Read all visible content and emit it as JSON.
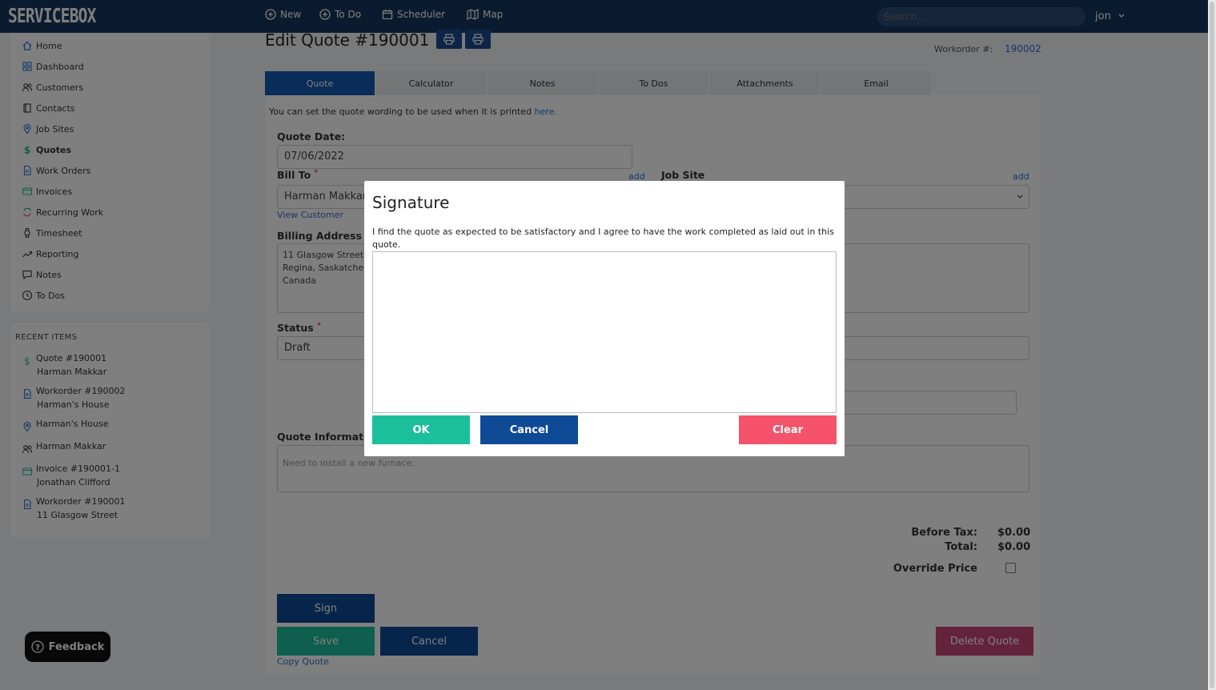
{
  "colors": {
    "navbar": "#17365e",
    "primary": "#0e5bb0",
    "ok": "#1cbf9b",
    "cancel": "#0e4a96",
    "clear": "#f4536b",
    "link": "#2a6fd6"
  },
  "topbar": {
    "logo": "SERVICEBOX",
    "nav": [
      {
        "label": "New",
        "icon": "plus-circle-icon"
      },
      {
        "label": "To Do",
        "icon": "plus-circle-icon"
      },
      {
        "label": "Scheduler",
        "icon": "calendar-icon"
      },
      {
        "label": "Map",
        "icon": "map-icon"
      }
    ],
    "search_placeholder": "Search...",
    "user": "jon"
  },
  "sidebar": {
    "items": [
      {
        "label": "Home",
        "icon": "home-icon"
      },
      {
        "label": "Dashboard",
        "icon": "grid-icon"
      },
      {
        "label": "Customers",
        "icon": "users-icon"
      },
      {
        "label": "Contacts",
        "icon": "book-icon"
      },
      {
        "label": "Job Sites",
        "icon": "location-pin-icon"
      },
      {
        "label": "Quotes",
        "icon": "dollar-icon",
        "active": true
      },
      {
        "label": "Work Orders",
        "icon": "document-icon"
      },
      {
        "label": "Invoices",
        "icon": "credit-card-icon"
      },
      {
        "label": "Recurring Work",
        "icon": "refresh-icon"
      },
      {
        "label": "Timesheet",
        "icon": "watch-icon"
      },
      {
        "label": "Reporting",
        "icon": "trend-icon"
      },
      {
        "label": "Notes",
        "icon": "chat-icon"
      },
      {
        "label": "To Dos",
        "icon": "clock-icon"
      }
    ],
    "recent_title": "RECENT ITEMS",
    "recent": [
      {
        "title": "Quote #190001",
        "sub": "Harman Makkar",
        "icon": "dollar-icon"
      },
      {
        "title": "Workorder #190002",
        "sub": "Harman's House",
        "icon": "document-icon"
      },
      {
        "title": "Harman's House",
        "sub": "",
        "icon": "location-pin-icon"
      },
      {
        "title": "Harman Makkar",
        "sub": "",
        "icon": "users-icon"
      },
      {
        "title": "Invoice #190001-1",
        "sub": "Jonathan Clifford",
        "icon": "credit-card-icon"
      },
      {
        "title": "Workorder #190001",
        "sub": "11 Glasgow Street",
        "icon": "document-icon"
      }
    ]
  },
  "feedback": "Feedback",
  "page": {
    "title": "Edit Quote #190001",
    "workorder_label": "Workorder #:",
    "workorder_number": "190002",
    "tabs": [
      "Quote",
      "Calculator",
      "Notes",
      "To Dos",
      "Attachments",
      "Email"
    ],
    "hint_text": "You can set the quote wording to be used when it is printed ",
    "hint_link": "here.",
    "quote_date_label": "Quote Date:",
    "quote_date": "07/06/2022",
    "bill_to_label": "Bill To",
    "bill_to_value": "Harman Makkar",
    "add_link": "add",
    "job_site_label": "Job Site",
    "view_customer": "View Customer",
    "billing_address_label": "Billing Address",
    "billing_address": [
      "11 Glasgow Street",
      "Regina, Saskatchewan",
      "Canada"
    ],
    "status_label": "Status",
    "status_value": "Draft",
    "quote_info_label": "Quote Information",
    "quote_info_placeholder": "Need to install a new furnace.",
    "before_tax_label": "Before Tax:",
    "before_tax_value": "$0.00",
    "total_label": "Total:",
    "total_value": "$0.00",
    "override_label": "Override Price",
    "sign_btn": "Sign",
    "save_btn": "Save",
    "cancel_btn": "Cancel",
    "copy_quote": "Copy Quote",
    "delete_btn": "Delete Quote"
  },
  "modal": {
    "title": "Signature",
    "text": "I find the quote as expected to be satisfactory and I agree to have the work completed as laid out in this quote.",
    "ok": "OK",
    "cancel": "Cancel",
    "clear": "Clear"
  }
}
